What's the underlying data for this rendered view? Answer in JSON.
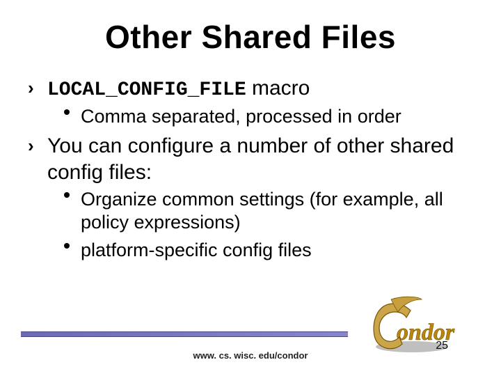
{
  "title": "Other Shared Files",
  "bullets": {
    "b1_code": "LOCAL_CONFIG_FILE",
    "b1_rest": " macro",
    "b1a": "Comma separated, processed in order",
    "b2": "You can configure a number of other shared config files:",
    "b2a": "Organize common settings (for example, all policy expressions)",
    "b2b": "platform-specific config files"
  },
  "footer_url": "www. cs. wisc. edu/condor",
  "slide_number": "25",
  "logo_text": "ondor"
}
